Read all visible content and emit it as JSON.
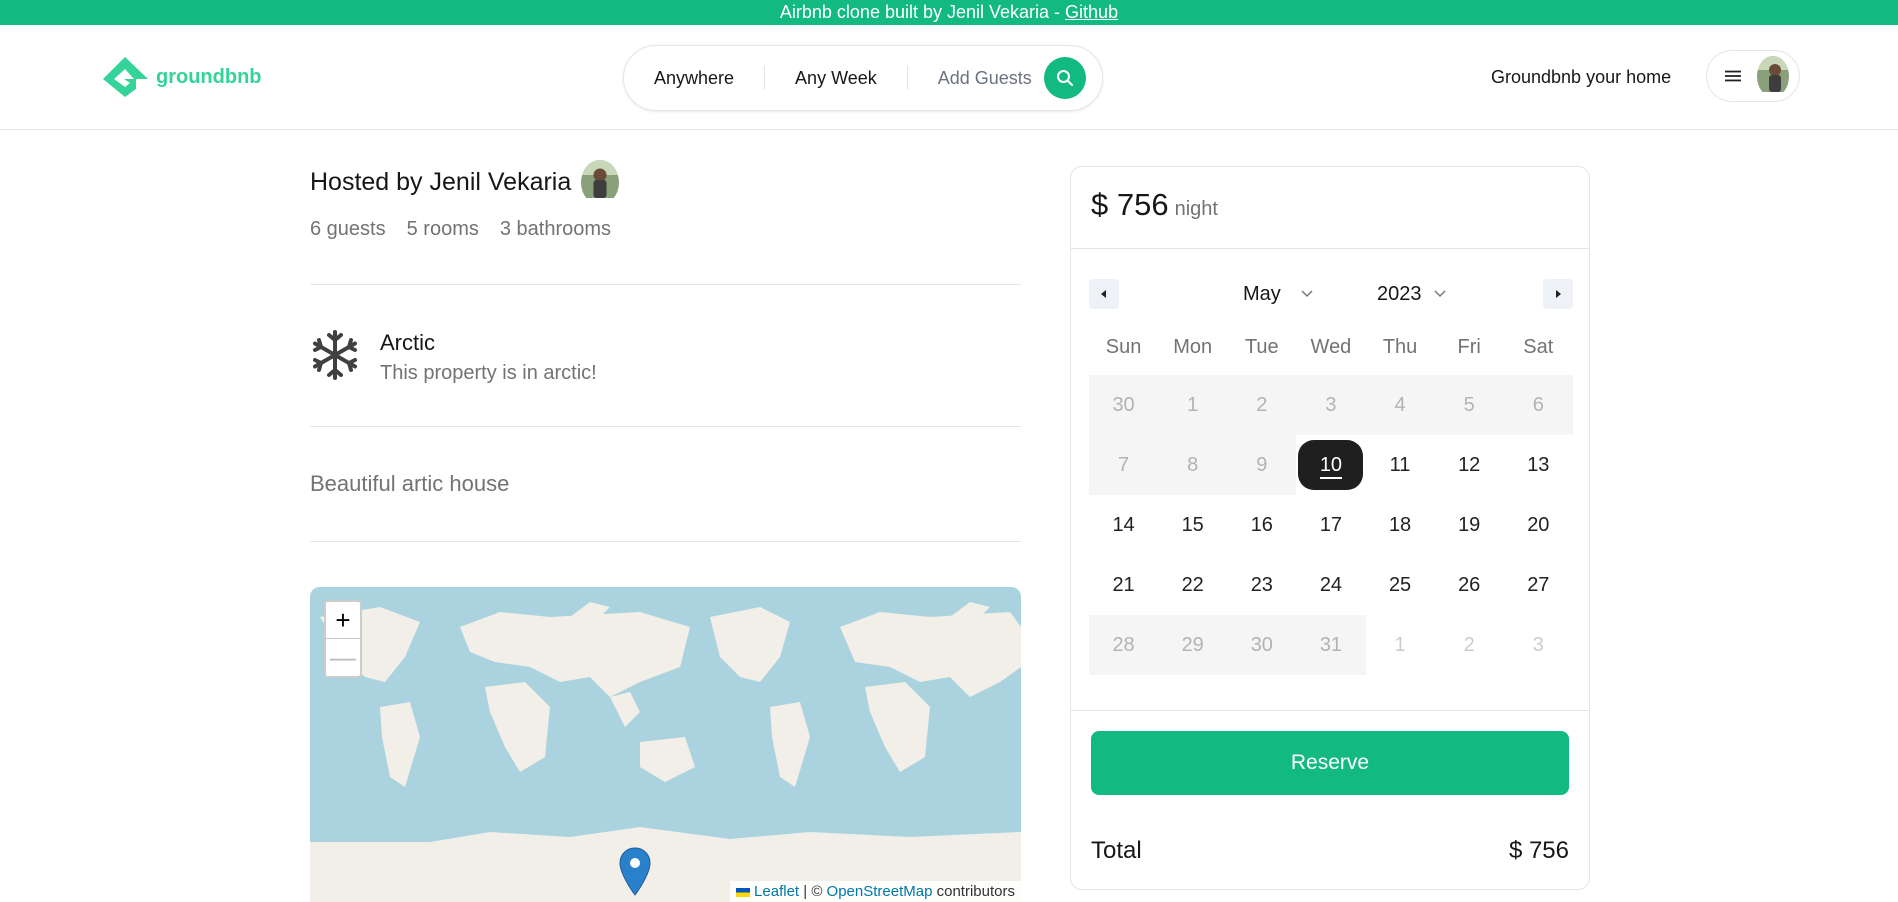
{
  "banner": {
    "text": "Airbnb clone built by Jenil Vekaria - ",
    "link": "Github"
  },
  "navbar": {
    "logo": "groundbnb",
    "search": {
      "where": "Anywhere",
      "when": "Any Week",
      "guests": "Add Guests"
    },
    "host_link": "Groundbnb your home"
  },
  "listing": {
    "host_line": "Hosted by Jenil Vekaria",
    "stats": [
      "6 guests",
      "5 rooms",
      "3 bathrooms"
    ],
    "category": {
      "title": "Arctic",
      "description": "This property is in arctic!",
      "icon": "snowflake-icon"
    },
    "description": "Beautiful artic house"
  },
  "map": {
    "zoom_in": "+",
    "zoom_out": "—",
    "attribution": {
      "leaflet": "Leaflet",
      "sep": " | © ",
      "osm": "OpenStreetMap",
      "tail": " contributors"
    }
  },
  "booking": {
    "price": "$ 756",
    "per": "night",
    "calendar": {
      "month": "May",
      "year": "2023",
      "weekdays": [
        "Sun",
        "Mon",
        "Tue",
        "Wed",
        "Thu",
        "Fri",
        "Sat"
      ],
      "weeks": [
        [
          "30",
          "1",
          "2",
          "3",
          "4",
          "5",
          "6"
        ],
        [
          "7",
          "8",
          "9",
          "10",
          "11",
          "12",
          "13"
        ],
        [
          "14",
          "15",
          "16",
          "17",
          "18",
          "19",
          "20"
        ],
        [
          "21",
          "22",
          "23",
          "24",
          "25",
          "26",
          "27"
        ],
        [
          "28",
          "29",
          "30",
          "31",
          "1",
          "2",
          "3"
        ]
      ],
      "selected": "10"
    },
    "reserve_label": "Reserve",
    "total_label": "Total",
    "total_value": "$ 756"
  },
  "colors": {
    "brand": "#12b981",
    "logo": "#34d399"
  }
}
